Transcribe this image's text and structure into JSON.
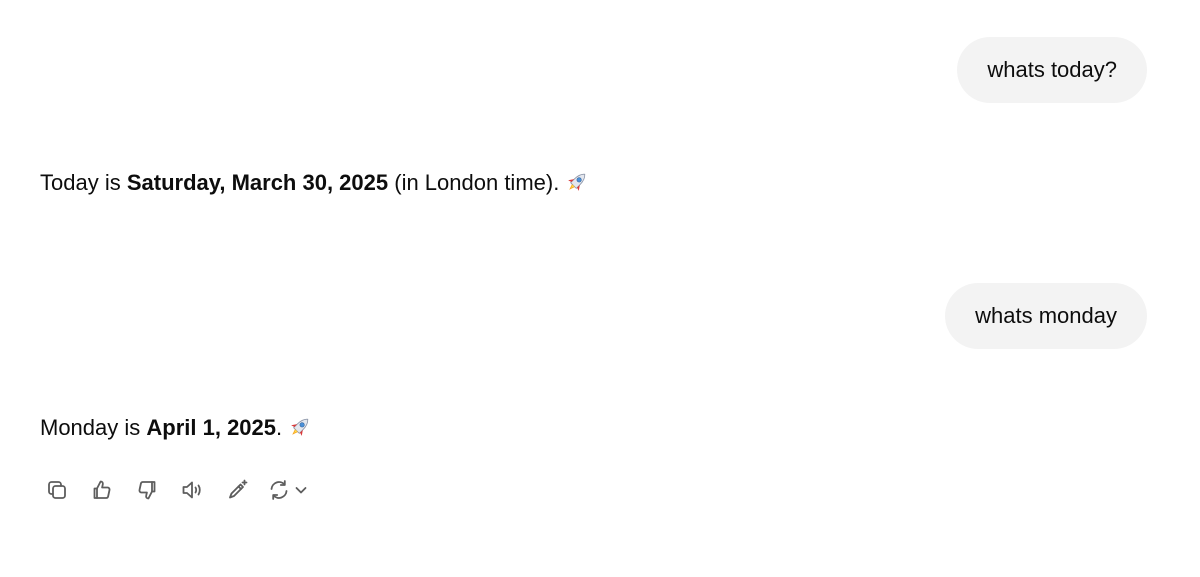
{
  "conversation": {
    "messages": [
      {
        "role": "user",
        "text": "whats today?"
      },
      {
        "role": "assistant",
        "pre": "Today is ",
        "bold": "Saturday, March 30, 2025",
        "post": " (in London time).",
        "emoji": "rocket"
      },
      {
        "role": "user",
        "text": "whats monday"
      },
      {
        "role": "assistant",
        "pre": "Monday is ",
        "bold": "April 1, 2025",
        "post": ".",
        "emoji": "rocket"
      }
    ]
  },
  "action_bar": {
    "icons": [
      "copy-icon",
      "thumbs-up-icon",
      "thumbs-down-icon",
      "read-aloud-icon",
      "edit-canvas-icon",
      "regenerate-icon",
      "chevron-down-icon"
    ]
  },
  "colors": {
    "user_bubble": "#f3f3f3",
    "text": "#0d0d0d",
    "icon": "#5d5d5d"
  }
}
